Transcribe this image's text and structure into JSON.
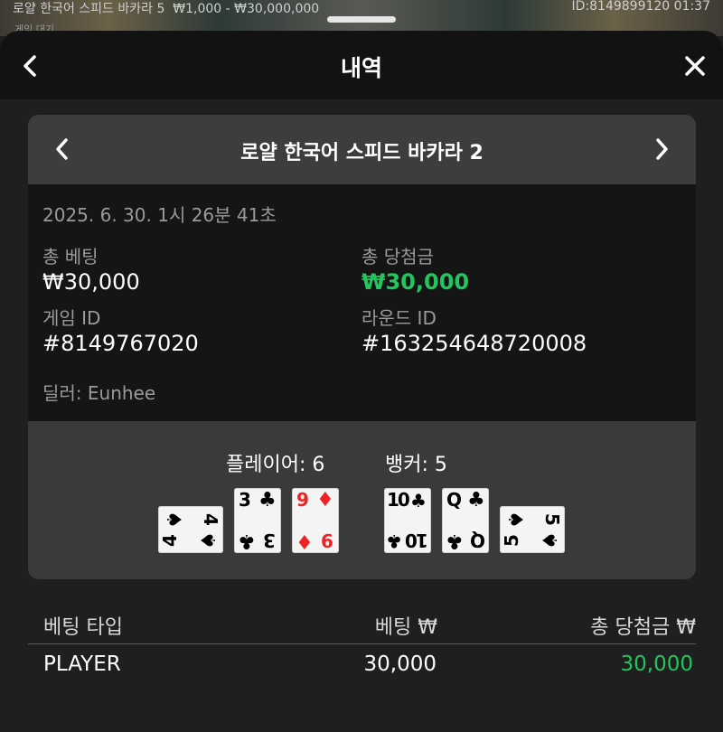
{
  "background": {
    "table_name": "로얄 한국어 스피드 바카라 5",
    "limits": "₩1,000 - ₩30,000,000",
    "id_time": "ID:8149899120   01:37",
    "sub_text": "게임 대기"
  },
  "header": {
    "title": "내역"
  },
  "game": {
    "title": "로얄 한국어 스피드 바카라 2",
    "datetime": "2025. 6. 30. 1시 26분 41초",
    "total_bet_label": "총 베팅",
    "total_bet_value": "₩30,000",
    "total_win_label": "총 당첨금",
    "total_win_value": "₩30,000",
    "game_id_label": "게임 ID",
    "game_id_value": "#8149767020",
    "round_id_label": "라운드 ID",
    "round_id_value": "#163254648720008",
    "dealer": "딜러: Eunhee"
  },
  "result": {
    "player_score": "플레이어: 6",
    "banker_score": "뱅커: 5",
    "player_cards": [
      {
        "rank": "4",
        "suit": "♠",
        "color": "black",
        "orientation": "sideways"
      },
      {
        "rank": "3",
        "suit": "♣",
        "color": "black",
        "orientation": "upright"
      },
      {
        "rank": "9",
        "suit": "♦",
        "color": "red",
        "orientation": "upright"
      }
    ],
    "banker_cards": [
      {
        "rank": "10",
        "suit": "♣",
        "color": "black",
        "orientation": "upright"
      },
      {
        "rank": "Q",
        "suit": "♣",
        "color": "black",
        "orientation": "upright"
      },
      {
        "rank": "5",
        "suit": "♠",
        "color": "black",
        "orientation": "sideways"
      }
    ]
  },
  "bets_table": {
    "headers": [
      "베팅 타입",
      "베팅 ₩",
      "총 당첨금 ₩"
    ],
    "rows": [
      {
        "type": "PLAYER",
        "bet": "30,000",
        "win": "30,000"
      }
    ]
  },
  "colors": {
    "win_green": "#22c55e",
    "card_red": "#ee2222"
  },
  "icons": [
    "chevron-left-icon",
    "close-icon",
    "chevron-right-icon",
    "spade-icon",
    "club-icon",
    "diamond-icon"
  ]
}
